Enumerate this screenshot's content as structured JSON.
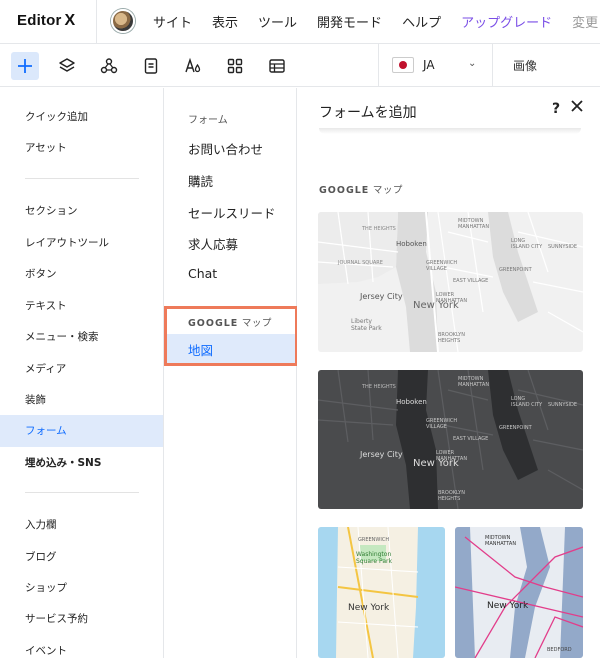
{
  "header": {
    "logo": "Editor",
    "logo_x": "X",
    "menu": [
      "サイト",
      "表示",
      "ツール",
      "開発モード",
      "ヘルプ",
      "アップグレード",
      "変更"
    ]
  },
  "toolbar": {
    "tools": [
      "add-icon",
      "layers-icon",
      "apps-icon",
      "pages-icon",
      "theme-icon",
      "grid-icon",
      "table-icon"
    ],
    "language": "JA",
    "image_label": "画像"
  },
  "leftnav": {
    "group1": [
      "クイック追加",
      "アセット"
    ],
    "group2": [
      "セクション",
      "レイアウトツール",
      "ボタン",
      "テキスト",
      "メニュー・検索",
      "メディア",
      "装飾",
      "フォーム",
      "埋め込み・SNS"
    ],
    "group3": [
      "入力欄",
      "ブログ",
      "ショップ",
      "サービス予約",
      "イベント"
    ],
    "active": "フォーム"
  },
  "midcol": {
    "forms_heading": "フォーム",
    "forms": [
      "お問い合わせ",
      "購読",
      "セールスリード",
      "求人応募",
      "Chat"
    ],
    "google_heading_bold": "GOOGLE",
    "google_heading_rest": "マップ",
    "google_item": "地図"
  },
  "panel": {
    "title": "フォームを追加",
    "help": "?",
    "section_bold": "GOOGLE",
    "section_rest": "マップ",
    "maps": {
      "city": "New York",
      "hoboken": "Hoboken",
      "jersey": "Jersey City",
      "midtown": "MIDTOWN\nMANHATTAN",
      "greenwich": "GREENWICH\nVILLAGE",
      "eastvillage": "EAST VILLAGE",
      "lic": "LONG\nISLAND CITY",
      "sunnyside": "SUNNYSIDE",
      "greenpoint": "GREENPOINT",
      "lowermanhattan": "LOWER\nMANHATTAN",
      "brooklyn": "BROOKLYN\nHEIGHTS",
      "theheights": "THE HEIGHTS",
      "journal": "JOURNAL SQUARE",
      "liberty": "Liberty\nState Park",
      "washington": "Washington\nSquare Park",
      "bedford": "BEDFORD"
    }
  },
  "colors": {
    "accent": "#116dff",
    "highlight_border": "#ee7a5a",
    "upgrade": "#7a4ee6",
    "active_bg": "#dfeafb"
  }
}
